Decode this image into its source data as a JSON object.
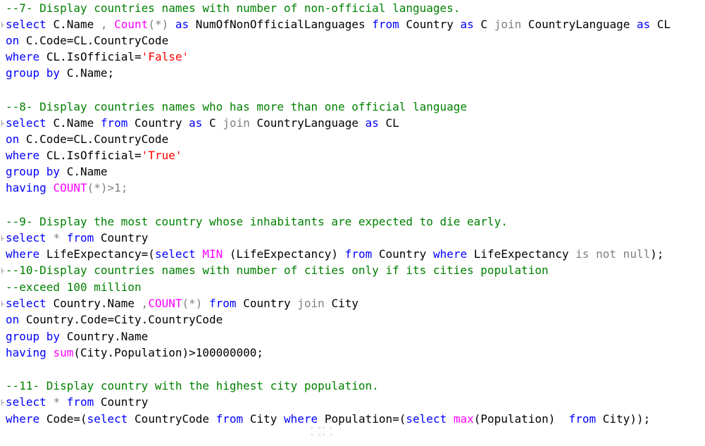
{
  "editor": {
    "blocks": [
      {
        "comment": "--7- Display countries names with number of non-official languages.",
        "sql": [
          [
            "select",
            "C.Name",
            ",",
            "Count",
            "(*)",
            "as",
            "NumOfNonOfficialLanguages",
            "from",
            "Country",
            "as",
            "C",
            "join",
            "CountryLanguage",
            "as",
            "CL"
          ],
          [
            "on",
            "C.Code=CL.CountryCode"
          ],
          [
            "where",
            "CL.IsOfficial=",
            "'False'"
          ],
          [
            "group by",
            "C.Name;"
          ]
        ]
      },
      {
        "comment": "--8- Display countries names who has more than one official language",
        "sql": [
          [
            "select",
            "C.Name",
            "from",
            "Country",
            "as",
            "C",
            "join",
            "CountryLanguage",
            "as",
            "CL"
          ],
          [
            "on",
            "C.Code=CL.CountryCode"
          ],
          [
            "where",
            "CL.IsOfficial=",
            "'True'"
          ],
          [
            "group by",
            "C.Name"
          ],
          [
            "having",
            "COUNT",
            "(*)>1;"
          ]
        ]
      },
      {
        "comment": "--9- Display the most country whose inhabitants are expected to die early.",
        "sql": [
          [
            "select",
            "*",
            "from",
            "Country"
          ],
          [
            "where",
            "LifeExpectancy=(",
            "select",
            "MIN",
            "(LifeExpectancy)",
            "from",
            "Country",
            "where",
            "LifeExpectancy",
            "is not null",
            ");"
          ]
        ]
      },
      {
        "comment": "--10-Display countries names with number of cities only if its cities population",
        "comment2": "--exceed 100 million",
        "sql": [
          [
            "select",
            "Country.Name",
            ",",
            "COUNT",
            "(*)",
            "from",
            "Country",
            "join",
            "City"
          ],
          [
            "on",
            "Country.Code=City.CountryCode"
          ],
          [
            "group by",
            "Country.Name"
          ],
          [
            "having",
            "sum",
            "(City.Population)>100000000;"
          ]
        ]
      },
      {
        "comment": "--11- Display country with the highest city population.",
        "sql": [
          [
            "select",
            "*",
            "from",
            "Country"
          ],
          [
            "where",
            "Code=(",
            "select",
            "CountryCode",
            "from",
            "City",
            "where",
            "Population=(",
            "select",
            "max",
            "(Population)",
            "from",
            "City));"
          ]
        ]
      }
    ]
  },
  "colors": {
    "comment": "#008000",
    "keyword": "#0000ff",
    "string": "#ff0000",
    "function": "#ff00ff",
    "operator": "#808080",
    "text": "#000000"
  }
}
